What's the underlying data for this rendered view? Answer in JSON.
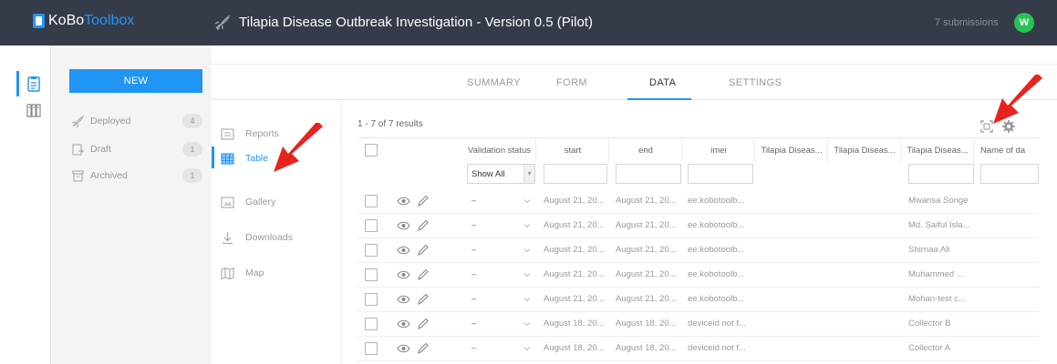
{
  "header": {
    "logo_kobo": "KoBo",
    "logo_toolbox": "Toolbox",
    "project_title": "Tilapia Disease Outbreak Investigation - Version 0.5 (Pilot)",
    "submissions": "7 submissions",
    "avatar_letter": "W",
    "avatar_color": "#23c552"
  },
  "sidebar": {
    "new_label": "NEW",
    "items": [
      {
        "label": "Deployed",
        "count": "4",
        "icon": "rocket-icon"
      },
      {
        "label": "Draft",
        "count": "1",
        "icon": "draft-icon"
      },
      {
        "label": "Archived",
        "count": "1",
        "icon": "archive-icon"
      }
    ]
  },
  "tabs": [
    {
      "label": "SUMMARY"
    },
    {
      "label": "FORM"
    },
    {
      "label": "DATA",
      "active": true
    },
    {
      "label": "SETTINGS"
    }
  ],
  "subnav": [
    {
      "label": "Reports",
      "icon": "reports-icon"
    },
    {
      "label": "Table",
      "icon": "table-icon",
      "active": true
    },
    {
      "label": "Gallery",
      "icon": "gallery-icon"
    },
    {
      "label": "Downloads",
      "icon": "download-icon"
    },
    {
      "label": "Map",
      "icon": "map-icon"
    }
  ],
  "table": {
    "results": "1 - 7 of 7 results",
    "columns": [
      "Validation status",
      "start",
      "end",
      "imei",
      "Tilapia Diseas...",
      "Tilapia Diseas...",
      "Tilapia Diseas...",
      "Name of da"
    ],
    "filter_value": "Show All",
    "rows": [
      {
        "status": "–",
        "start": "August 21, 20...",
        "end": "August 21, 20...",
        "imei": "ee.kobotoolb...",
        "name": "Mwansa Songe"
      },
      {
        "status": "–",
        "start": "August 21, 20...",
        "end": "August 21, 20...",
        "imei": "ee.kobotoolb...",
        "name": "Md. Saiful Isla..."
      },
      {
        "status": "–",
        "start": "August 21, 20...",
        "end": "August 21, 20...",
        "imei": "ee.kobotoolb...",
        "name": "Shirnaa Ali"
      },
      {
        "status": "–",
        "start": "August 21, 20...",
        "end": "August 21, 20...",
        "imei": "ee.kobotoolb...",
        "name": "Muhammed ..."
      },
      {
        "status": "–",
        "start": "August 21, 20...",
        "end": "August 21, 20...",
        "imei": "ee.kobotoolb...",
        "name": "Mohan-test c..."
      },
      {
        "status": "–",
        "start": "August 18, 20...",
        "end": "August 18, 20...",
        "imei": "deviceid not f...",
        "name": "Collector B"
      },
      {
        "status": "–",
        "start": "August 18, 20...",
        "end": "August 18, 20...",
        "imei": "deviceid not f...",
        "name": "Collector A"
      }
    ]
  },
  "colors": {
    "header_bg": "#363b4a",
    "accent": "#2095f3",
    "annotation_arrow": "#e8231e"
  }
}
